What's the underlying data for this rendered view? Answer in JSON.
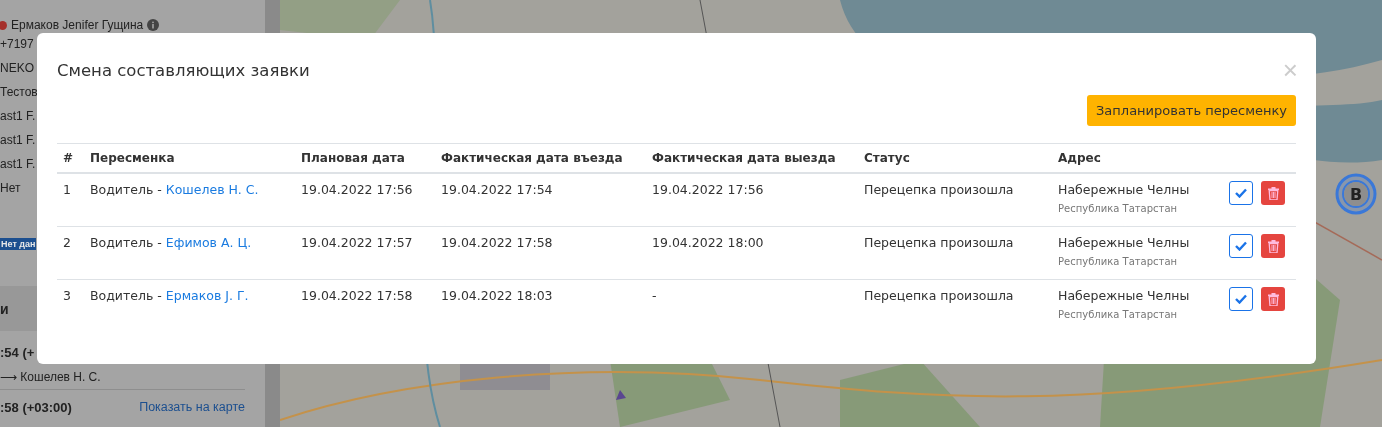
{
  "sidebar": {
    "driver": {
      "name": "Ермаков Jenifer Гущина",
      "color": "#a5302b"
    },
    "lines": [
      "+7197",
      "NEKO",
      "Тестов",
      "ast1 F.",
      "ast1 F.",
      "ast1 F.",
      "Нет"
    ],
    "badge": "Нет дан",
    "section_title": "и",
    "events": [
      {
        "time": ":54 (+",
        "route": "⟶ Кошелев Н. С."
      },
      {
        "time": ":58 (+03:00)",
        "link": "Показать на карте"
      }
    ]
  },
  "map": {
    "marker": "B"
  },
  "dialog": {
    "title": "Смена составляющих заявки",
    "close": "×",
    "action": "Запланировать пересменку",
    "columns": [
      "#",
      "Пересменка",
      "Плановая дата",
      "Фактическая дата въезда",
      "Фактическая дата выезда",
      "Статус",
      "Адрес"
    ],
    "rows": [
      {
        "number": "1",
        "role": "Водитель -",
        "driver": "Кошелев Н. С.",
        "planned": "19.04.2022 17:56",
        "arrival": "19.04.2022 17:54",
        "departure": "19.04.2022 17:56",
        "status": "Перецепка произошла",
        "city": "Набережные Челны",
        "region": "Республика Татарстан"
      },
      {
        "number": "2",
        "role": "Водитель -",
        "driver": "Ефимов А. Ц.",
        "planned": "19.04.2022 17:57",
        "arrival": "19.04.2022 17:58",
        "departure": "19.04.2022 18:00",
        "status": "Перецепка произошла",
        "city": "Набережные Челны",
        "region": "Республика Татарстан"
      },
      {
        "number": "3",
        "role": "Водитель -",
        "driver": "Ермаков J. Г.",
        "planned": "19.04.2022 17:58",
        "arrival": "19.04.2022 18:03",
        "departure": "-",
        "status": "Перецепка произошла",
        "city": "Набережные Челны",
        "region": "Республика Татарстан"
      }
    ]
  }
}
